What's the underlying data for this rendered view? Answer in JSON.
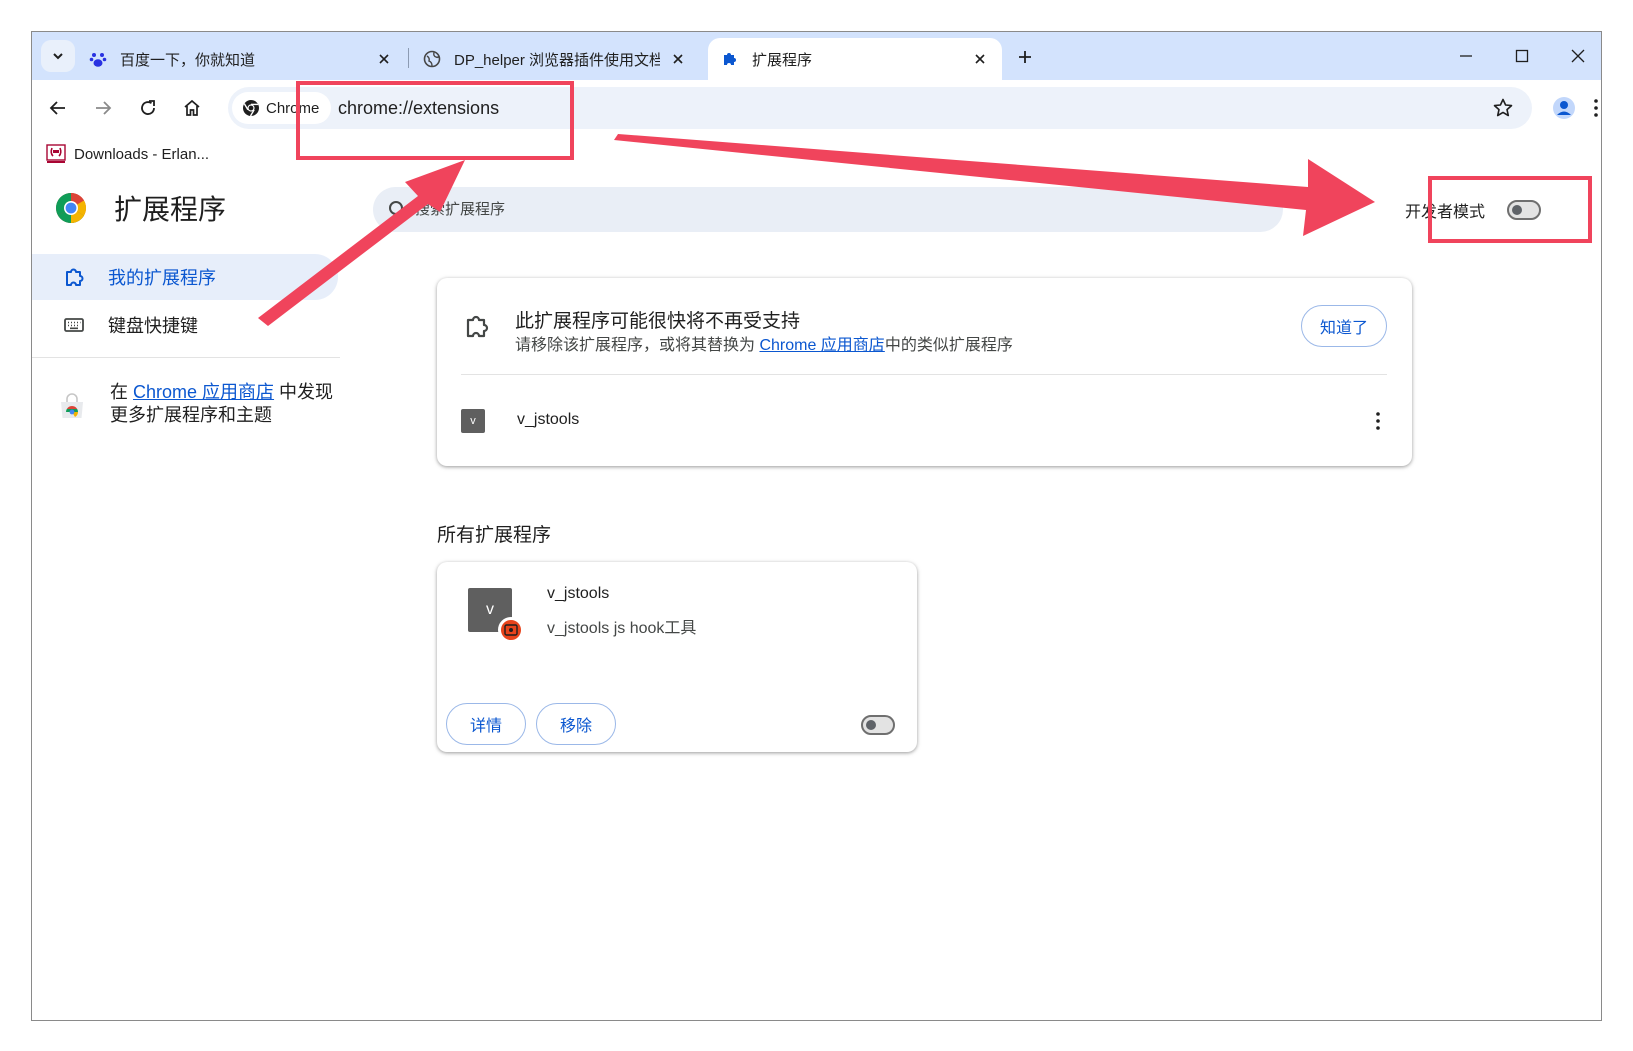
{
  "tabs": [
    {
      "title": "百度一下，你就知道",
      "icon": "baidu-paw-icon"
    },
    {
      "title": "DP_helper 浏览器插件使用文档",
      "icon": "globe-icon"
    },
    {
      "title": "扩展程序",
      "icon": "puzzle-icon",
      "active": true
    }
  ],
  "toolbar": {
    "chip_label": "Chrome",
    "url": "chrome://extensions"
  },
  "bookmarks": [
    {
      "label": "Downloads - Erlan...",
      "icon": "erlang-logo-icon"
    }
  ],
  "page": {
    "title": "扩展程序",
    "search_placeholder": "搜索扩展程序",
    "dev_mode_label": "开发者模式",
    "dev_mode_on": false
  },
  "sidebar": {
    "items": [
      {
        "label": "我的扩展程序",
        "icon": "extensions-icon",
        "active": true
      },
      {
        "label": "键盘快捷键",
        "icon": "keyboard-icon"
      }
    ],
    "promo": {
      "prefix": "在 ",
      "link": "Chrome 应用商店",
      "suffix": " 中发现",
      "line2": "更多扩展程序和主题"
    }
  },
  "warning": {
    "title": "此扩展程序可能很快将不再受支持",
    "sub_prefix": "请移除该扩展程序，或将其替换为 ",
    "sub_link": "Chrome 应用商店",
    "sub_suffix": "中的类似扩展程序",
    "button": "知道了",
    "ext_icon_letter": "v",
    "ext_name": "v_jstools"
  },
  "all_extensions": {
    "title": "所有扩展程序",
    "items": [
      {
        "name": "v_jstools",
        "description": "v_jstools js hook工具",
        "icon_letter": "v",
        "details_label": "详情",
        "remove_label": "移除",
        "enabled": false
      }
    ]
  },
  "colors": {
    "tabstrip": "#d3e3fd",
    "accent": "#0b57d0",
    "annotation": "#f0445c"
  }
}
